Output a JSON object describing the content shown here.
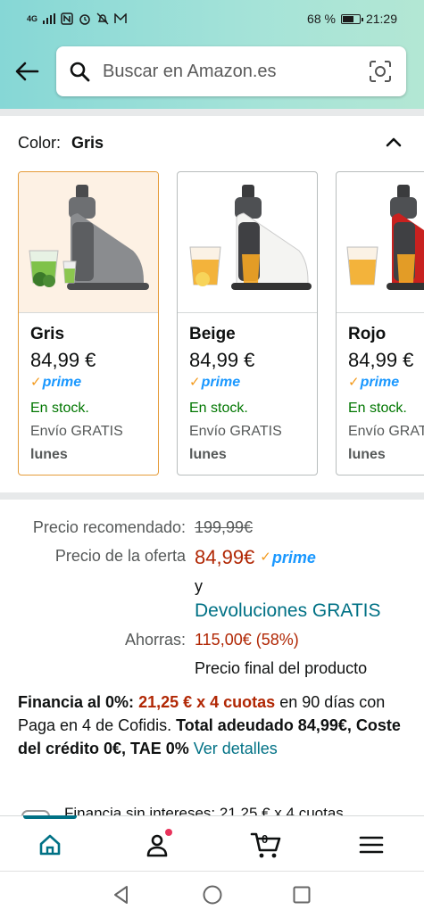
{
  "status_bar": {
    "network": "4G",
    "battery": "68 %",
    "battery_level": 0.68,
    "time": "21:29"
  },
  "search": {
    "placeholder": "Buscar en Amazon.es"
  },
  "color_selector": {
    "label": "Color:",
    "selected": "Gris",
    "variants": [
      {
        "name": "Gris",
        "price": "84,99 €",
        "prime": "prime",
        "stock": "En stock.",
        "shipping": "Envío GRATIS",
        "delivery": "lunes",
        "accent": "#7a7c7f"
      },
      {
        "name": "Beige",
        "price": "84,99 €",
        "prime": "prime",
        "stock": "En stock.",
        "shipping": "Envío GRATIS",
        "delivery": "lunes",
        "accent": "#f4f4f2"
      },
      {
        "name": "Rojo",
        "price": "84,99 €",
        "prime": "prime",
        "stock": "En stock.",
        "shipping": "Envío GRATIS",
        "delivery": "lunes",
        "accent": "#c8211f"
      }
    ]
  },
  "pricing": {
    "list_price_label": "Precio recomendado:",
    "list_price": "199,99€",
    "deal_label": "Precio de la oferta",
    "deal_price": "84,99€",
    "prime": "prime",
    "and": "y",
    "returns": "Devoluciones GRATIS",
    "savings_label": "Ahorras:",
    "savings": "115,00€ (58%)",
    "final_note": "Precio final del producto"
  },
  "financing": {
    "part1": "Financia al 0%:",
    "part2": "21,25 € x 4 cuotas",
    "part3": "en 90 días con Paga en 4 de Cofidis.",
    "part4": "Total adeudado 84,99€, Coste del crédito 0€, TAE 0%",
    "link": "Ver detalles"
  },
  "peek_text": "Financia sin intereses: 21,25 € x 4 cuotas",
  "bottom_nav": {
    "cart_count": "0"
  },
  "colors": {
    "accent_teal": "#007185",
    "price_red": "#b12704",
    "prime_blue": "#1a98ff",
    "stock_green": "#007600",
    "selected_border": "#e59b38"
  }
}
